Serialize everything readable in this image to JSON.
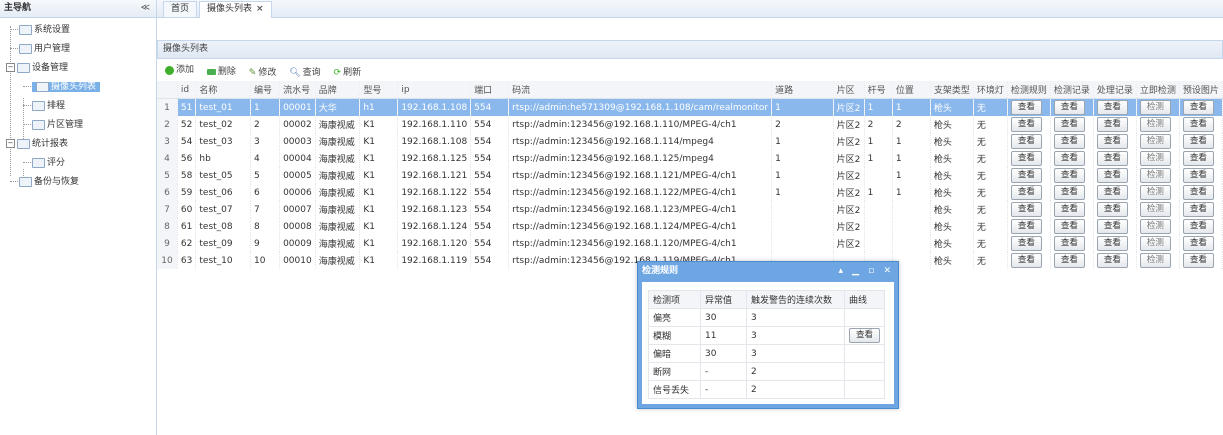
{
  "sidebar": {
    "title": "主导航",
    "collapse": "≪",
    "items": [
      {
        "label": "系统设置"
      },
      {
        "label": "用户管理"
      },
      {
        "label": "设备管理"
      },
      {
        "label": "摄像头列表"
      },
      {
        "label": "排程"
      },
      {
        "label": "片区管理"
      },
      {
        "label": "统计报表"
      },
      {
        "label": "评分"
      },
      {
        "label": "备份与恢复"
      }
    ]
  },
  "tabs": [
    {
      "label": "首页"
    },
    {
      "label": "摄像头列表",
      "close": "×"
    }
  ],
  "panel": {
    "title": "摄像头列表",
    "toolbar": {
      "add": "添加",
      "delete": "删除",
      "edit": "修改",
      "query": "查询",
      "refresh": "刷新"
    }
  },
  "grid": {
    "columns": [
      "id",
      "名称",
      "编号",
      "流水号",
      "品牌",
      "型号",
      "ip",
      "端口",
      "码流",
      "道路",
      "片区",
      "杆号",
      "位置",
      "支架类型",
      "环境灯",
      "检测规则",
      "检测记录",
      "处理记录",
      "立即检测",
      "预设图片"
    ],
    "rows": [
      {
        "rn": "1",
        "id": "51",
        "name": "test_01",
        "num": "1",
        "serial": "00001",
        "brand": "大华",
        "model": "h1",
        "ip": "192.168.1.108",
        "port": "554",
        "stream": "rtsp://admin:he571309@192.168.1.108/cam/realmonitor",
        "road": "1",
        "area": "片区2",
        "pole": "1",
        "pos": "1",
        "mount": "枪头",
        "light": "无",
        "b1": "查看",
        "b2": "查看",
        "b3": "查看",
        "b4": "检测",
        "b5": "查看"
      },
      {
        "rn": "2",
        "id": "52",
        "name": "test_02",
        "num": "2",
        "serial": "00002",
        "brand": "海康视威",
        "model": "K1",
        "ip": "192.168.1.110",
        "port": "554",
        "stream": "rtsp://admin:123456@192.168.1.110/MPEG-4/ch1",
        "road": "2",
        "area": "片区2",
        "pole": "2",
        "pos": "2",
        "mount": "枪头",
        "light": "无",
        "b1": "查看",
        "b2": "查看",
        "b3": "查看",
        "b4": "检测",
        "b5": "查看"
      },
      {
        "rn": "3",
        "id": "54",
        "name": "test_03",
        "num": "3",
        "serial": "00003",
        "brand": "海康视威",
        "model": "K1",
        "ip": "192.168.1.108",
        "port": "554",
        "stream": "rtsp://admin:123456@192.168.1.114/mpeg4",
        "road": "1",
        "area": "片区2",
        "pole": "1",
        "pos": "1",
        "mount": "枪头",
        "light": "无",
        "b1": "查看",
        "b2": "查看",
        "b3": "查看",
        "b4": "检测",
        "b5": "查看"
      },
      {
        "rn": "4",
        "id": "56",
        "name": "hb",
        "num": "4",
        "serial": "00004",
        "brand": "海康视威",
        "model": "K1",
        "ip": "192.168.1.125",
        "port": "554",
        "stream": "rtsp://admin:123456@192.168.1.125/mpeg4",
        "road": "1",
        "area": "片区2",
        "pole": "1",
        "pos": "1",
        "mount": "枪头",
        "light": "无",
        "b1": "查看",
        "b2": "查看",
        "b3": "查看",
        "b4": "检测",
        "b5": "查看"
      },
      {
        "rn": "5",
        "id": "58",
        "name": "test_05",
        "num": "5",
        "serial": "00005",
        "brand": "海康视威",
        "model": "K1",
        "ip": "192.168.1.121",
        "port": "554",
        "stream": "rtsp://admin:123456@192.168.1.121/MPEG-4/ch1",
        "road": "1",
        "area": "片区2",
        "pole": "",
        "pos": "1",
        "mount": "枪头",
        "light": "无",
        "b1": "查看",
        "b2": "查看",
        "b3": "查看",
        "b4": "检测",
        "b5": "查看"
      },
      {
        "rn": "6",
        "id": "59",
        "name": "test_06",
        "num": "6",
        "serial": "00006",
        "brand": "海康视威",
        "model": "K1",
        "ip": "192.168.1.122",
        "port": "554",
        "stream": "rtsp://admin:123456@192.168.1.122/MPEG-4/ch1",
        "road": "1",
        "area": "片区2",
        "pole": "1",
        "pos": "1",
        "mount": "枪头",
        "light": "无",
        "b1": "查看",
        "b2": "查看",
        "b3": "查看",
        "b4": "检测",
        "b5": "查看"
      },
      {
        "rn": "7",
        "id": "60",
        "name": "test_07",
        "num": "7",
        "serial": "00007",
        "brand": "海康视威",
        "model": "K1",
        "ip": "192.168.1.123",
        "port": "554",
        "stream": "rtsp://admin:123456@192.168.1.123/MPEG-4/ch1",
        "road": "",
        "area": "片区2",
        "pole": "",
        "pos": "",
        "mount": "枪头",
        "light": "无",
        "b1": "查看",
        "b2": "查看",
        "b3": "查看",
        "b4": "检测",
        "b5": "查看"
      },
      {
        "rn": "8",
        "id": "61",
        "name": "test_08",
        "num": "8",
        "serial": "00008",
        "brand": "海康视威",
        "model": "K1",
        "ip": "192.168.1.124",
        "port": "554",
        "stream": "rtsp://admin:123456@192.168.1.124/MPEG-4/ch1",
        "road": "",
        "area": "片区2",
        "pole": "",
        "pos": "",
        "mount": "枪头",
        "light": "无",
        "b1": "查看",
        "b2": "查看",
        "b3": "查看",
        "b4": "检测",
        "b5": "查看"
      },
      {
        "rn": "9",
        "id": "62",
        "name": "test_09",
        "num": "9",
        "serial": "00009",
        "brand": "海康视威",
        "model": "K1",
        "ip": "192.168.1.120",
        "port": "554",
        "stream": "rtsp://admin:123456@192.168.1.120/MPEG-4/ch1",
        "road": "",
        "area": "片区2",
        "pole": "",
        "pos": "",
        "mount": "枪头",
        "light": "无",
        "b1": "查看",
        "b2": "查看",
        "b3": "查看",
        "b4": "检测",
        "b5": "查看"
      },
      {
        "rn": "10",
        "id": "63",
        "name": "test_10",
        "num": "10",
        "serial": "00010",
        "brand": "海康视威",
        "model": "K1",
        "ip": "192.168.1.119",
        "port": "554",
        "stream": "rtsp://admin:123456@192.168.1.119/MPEG-4/ch1",
        "road": "",
        "area": "",
        "pole": "",
        "pos": "",
        "mount": "枪头",
        "light": "无",
        "b1": "查看",
        "b2": "查看",
        "b3": "查看",
        "b4": "检测",
        "b5": "查看"
      }
    ]
  },
  "dialog": {
    "title": "检测规则",
    "controls": "▴ ▁ ▫ ✕",
    "columns": [
      "检测项",
      "异常值",
      "触发警告的连续次数",
      "曲线"
    ],
    "rows": [
      {
        "item": "偏亮",
        "value": "30",
        "count": "3",
        "curve": ""
      },
      {
        "item": "模糊",
        "value": "11",
        "count": "3",
        "curve": "查看"
      },
      {
        "item": "偏暗",
        "value": "30",
        "count": "3",
        "curve": ""
      },
      {
        "item": "断网",
        "value": "-",
        "count": "2",
        "curve": ""
      },
      {
        "item": "信号丢失",
        "value": "-",
        "count": "2",
        "curve": ""
      }
    ]
  },
  "colors": {
    "accent": "#8ab8ec",
    "dialog_frame": "#6ea6e3",
    "border": "#c5d7ec"
  }
}
